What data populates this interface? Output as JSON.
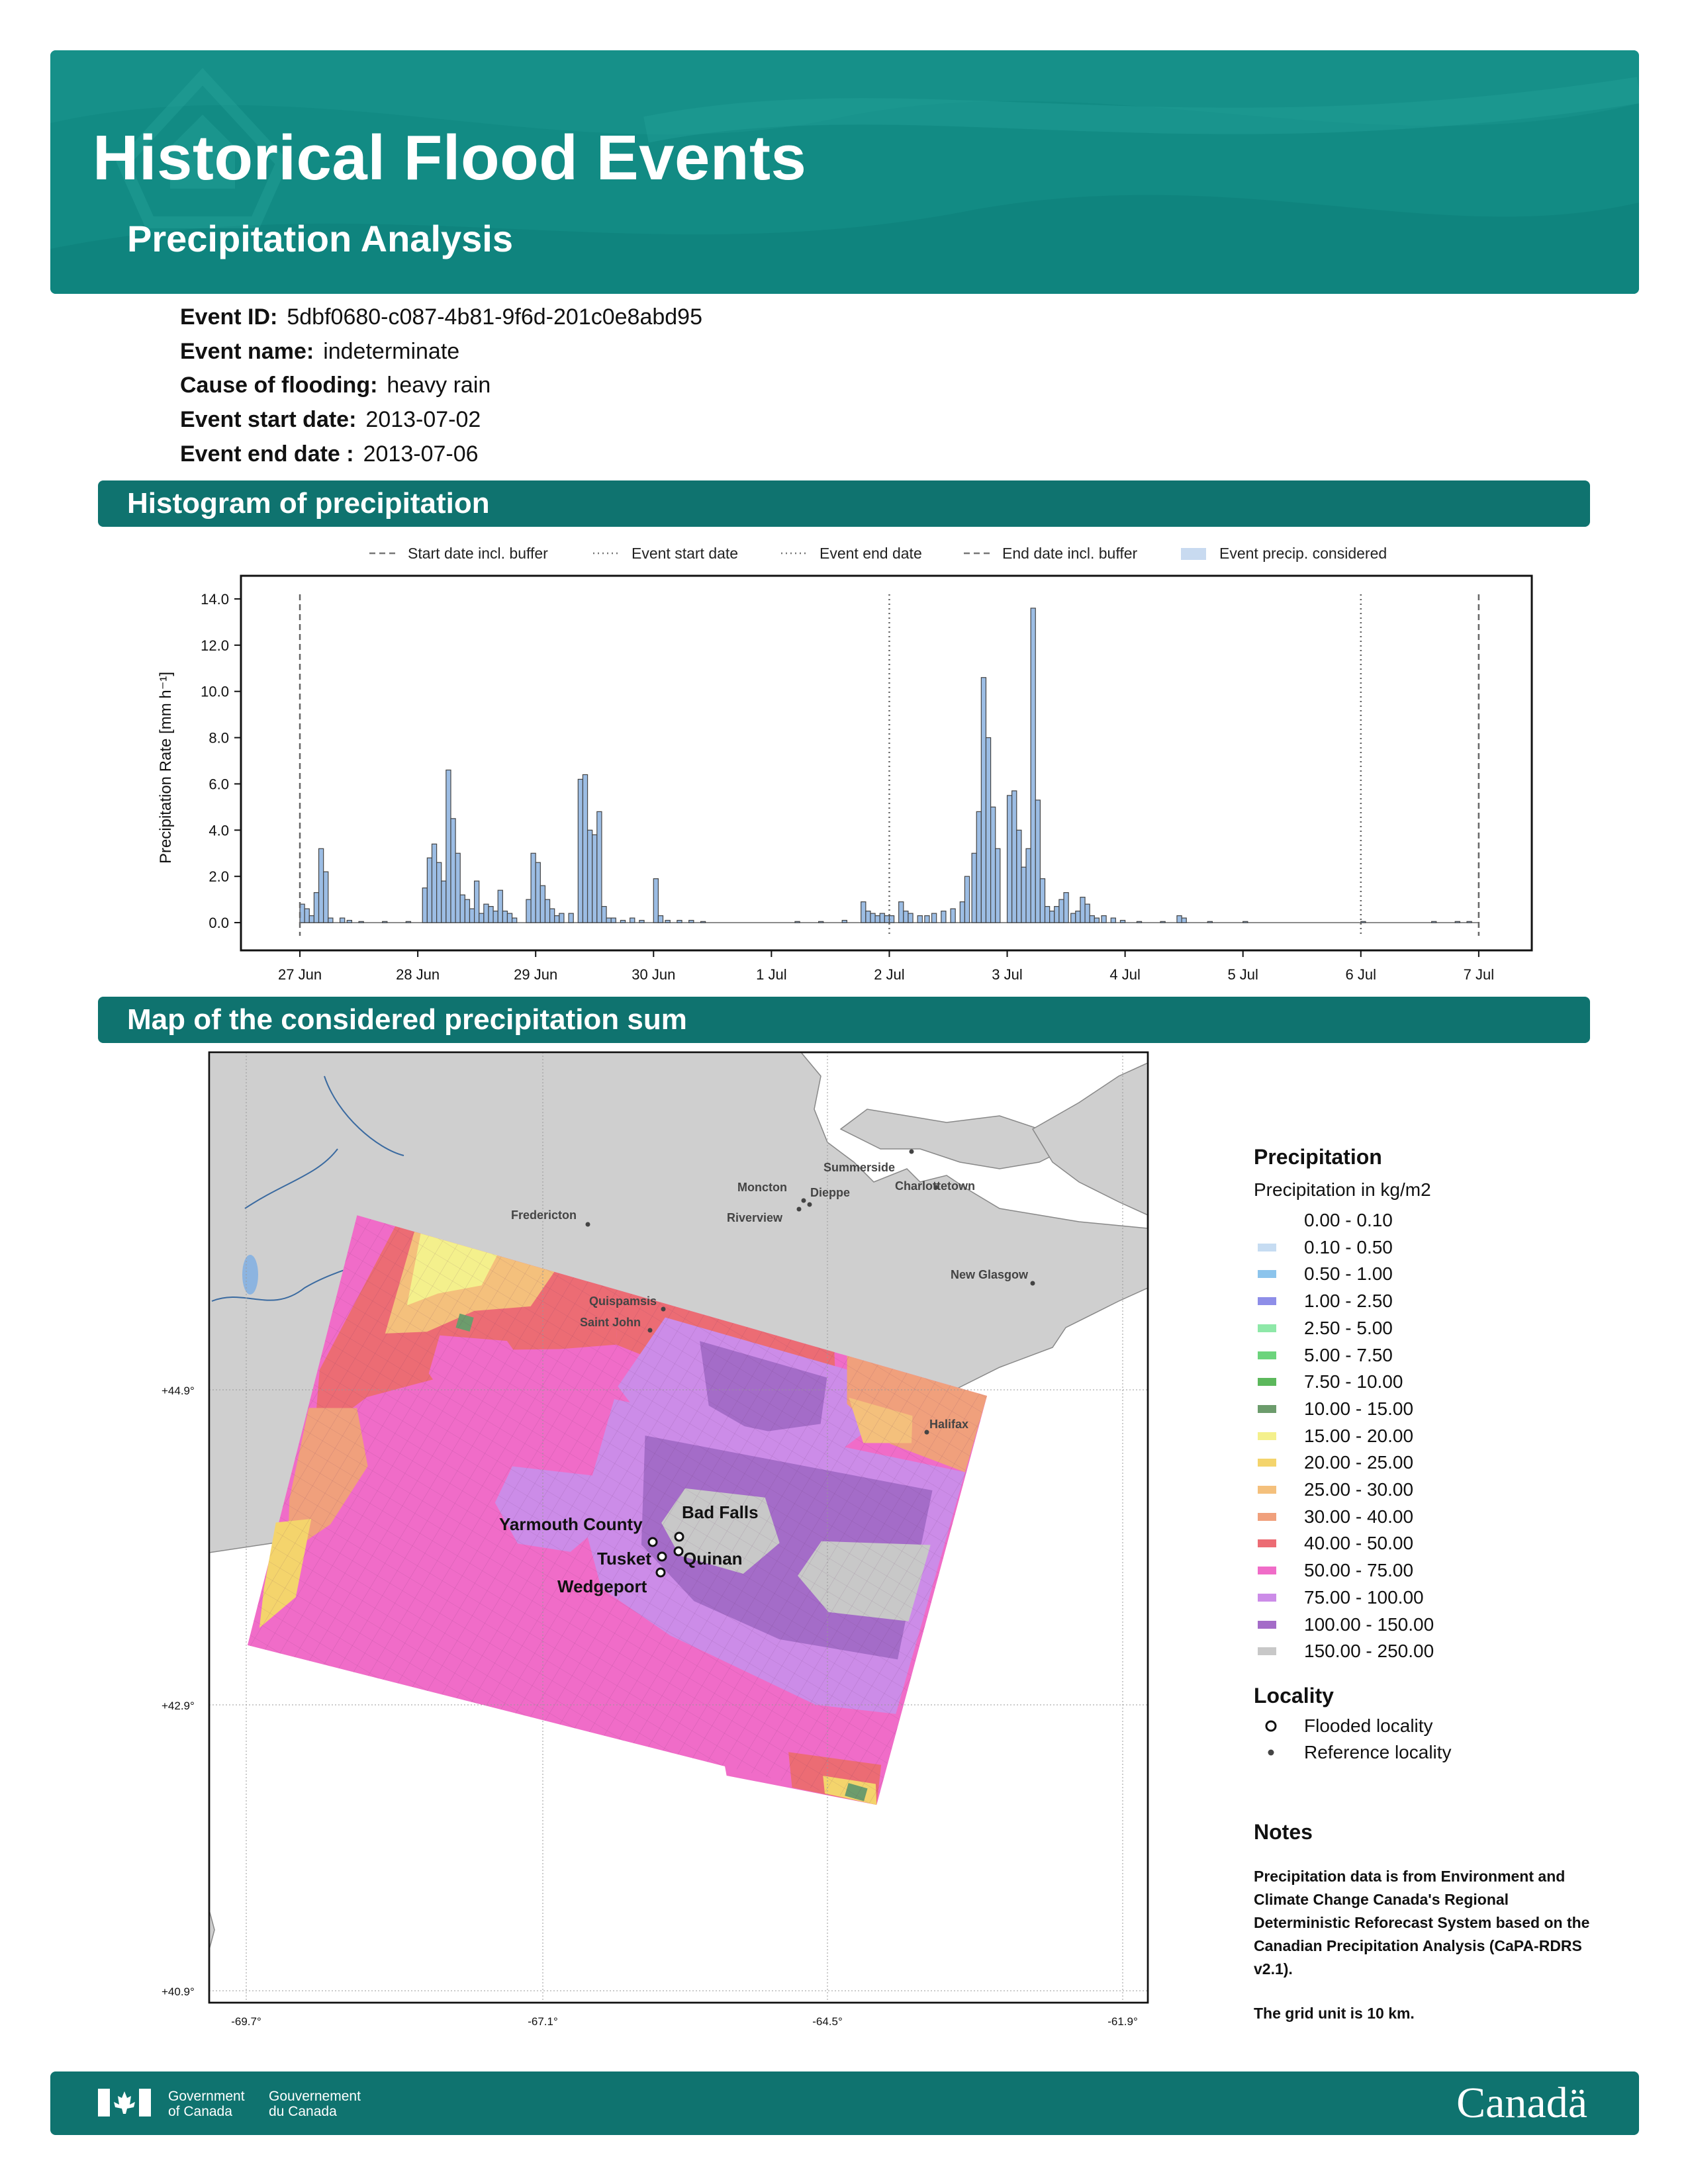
{
  "header": {
    "title": "Historical Flood Events",
    "subtitle": "Precipitation Analysis"
  },
  "event": {
    "id_label": "Event ID:",
    "id": "5dbf0680-c087-4b81-9f6d-201c0e8abd95",
    "name_label": "Event name:",
    "name": "indeterminate",
    "cause_label": "Cause of flooding:",
    "cause": "heavy rain",
    "start_label": "Event start date:",
    "start": "2013-07-02",
    "end_label": "Event end date :",
    "end": "2013-07-06"
  },
  "sections": {
    "histogram": "Histogram of precipitation",
    "map": "Map of the considered precipitation sum"
  },
  "chart_data": {
    "type": "bar",
    "ylabel": "Precipitation Rate [mm h⁻¹]",
    "ylim": [
      -1.2,
      15.0
    ],
    "yticks": [
      "0.0",
      "2.0",
      "4.0",
      "6.0",
      "8.0",
      "10.0",
      "12.0",
      "14.0"
    ],
    "xticks": [
      "27 Jun",
      "28 Jun",
      "29 Jun",
      "30 Jun",
      "1 Jul",
      "2 Jul",
      "3 Jul",
      "4 Jul",
      "5 Jul",
      "6 Jul",
      "7 Jul"
    ],
    "xlim_days": [
      -0.5,
      10.45
    ],
    "legend": {
      "position": "top",
      "items": [
        "Start date incl. buffer",
        "Event start date",
        "Event end date",
        "End date incl. buffer",
        "Event precip. considered"
      ]
    },
    "vlines": [
      {
        "name": "Start date incl. buffer",
        "day": 0.0,
        "style": "dashed"
      },
      {
        "name": "Event start date",
        "day": 5.0,
        "style": "dotted"
      },
      {
        "name": "Event end date",
        "day": 9.0,
        "style": "dotted"
      },
      {
        "name": "End date incl. buffer",
        "day": 10.0,
        "style": "dashed"
      }
    ],
    "bin_width_days": 0.04,
    "points": [
      [
        0.0,
        0.8
      ],
      [
        0.04,
        0.6
      ],
      [
        0.08,
        0.3
      ],
      [
        0.12,
        1.3
      ],
      [
        0.16,
        3.2
      ],
      [
        0.2,
        2.2
      ],
      [
        0.24,
        0.2
      ],
      [
        0.34,
        0.2
      ],
      [
        0.4,
        0.1
      ],
      [
        0.5,
        0.05
      ],
      [
        0.7,
        0.05
      ],
      [
        0.9,
        0.05
      ],
      [
        1.04,
        1.5
      ],
      [
        1.08,
        2.8
      ],
      [
        1.12,
        3.4
      ],
      [
        1.16,
        2.6
      ],
      [
        1.2,
        1.8
      ],
      [
        1.24,
        6.6
      ],
      [
        1.28,
        4.5
      ],
      [
        1.32,
        3.0
      ],
      [
        1.36,
        1.2
      ],
      [
        1.4,
        1.0
      ],
      [
        1.44,
        0.6
      ],
      [
        1.48,
        1.8
      ],
      [
        1.52,
        0.4
      ],
      [
        1.56,
        0.8
      ],
      [
        1.6,
        0.7
      ],
      [
        1.64,
        0.5
      ],
      [
        1.68,
        1.4
      ],
      [
        1.72,
        0.5
      ],
      [
        1.76,
        0.4
      ],
      [
        1.8,
        0.2
      ],
      [
        1.92,
        1.0
      ],
      [
        1.96,
        3.0
      ],
      [
        2.0,
        2.6
      ],
      [
        2.04,
        1.6
      ],
      [
        2.08,
        1.0
      ],
      [
        2.12,
        0.6
      ],
      [
        2.16,
        0.3
      ],
      [
        2.2,
        0.4
      ],
      [
        2.28,
        0.4
      ],
      [
        2.36,
        6.2
      ],
      [
        2.4,
        6.4
      ],
      [
        2.44,
        4.0
      ],
      [
        2.48,
        3.8
      ],
      [
        2.52,
        4.8
      ],
      [
        2.56,
        0.7
      ],
      [
        2.6,
        0.2
      ],
      [
        2.64,
        0.2
      ],
      [
        2.72,
        0.1
      ],
      [
        2.8,
        0.2
      ],
      [
        2.88,
        0.1
      ],
      [
        3.0,
        1.9
      ],
      [
        3.04,
        0.3
      ],
      [
        3.1,
        0.1
      ],
      [
        3.2,
        0.1
      ],
      [
        3.3,
        0.1
      ],
      [
        3.4,
        0.05
      ],
      [
        4.2,
        0.05
      ],
      [
        4.4,
        0.05
      ],
      [
        4.6,
        0.1
      ],
      [
        4.76,
        0.9
      ],
      [
        4.8,
        0.5
      ],
      [
        4.84,
        0.4
      ],
      [
        4.88,
        0.3
      ],
      [
        4.92,
        0.4
      ],
      [
        4.96,
        0.3
      ],
      [
        5.0,
        0.3
      ],
      [
        5.08,
        0.9
      ],
      [
        5.12,
        0.5
      ],
      [
        5.16,
        0.4
      ],
      [
        5.24,
        0.3
      ],
      [
        5.3,
        0.3
      ],
      [
        5.36,
        0.4
      ],
      [
        5.44,
        0.5
      ],
      [
        5.52,
        0.6
      ],
      [
        5.6,
        0.9
      ],
      [
        5.64,
        2.0
      ],
      [
        5.7,
        3.0
      ],
      [
        5.74,
        4.8
      ],
      [
        5.78,
        10.6
      ],
      [
        5.82,
        8.0
      ],
      [
        5.86,
        5.0
      ],
      [
        5.9,
        3.2
      ],
      [
        6.0,
        5.5
      ],
      [
        6.04,
        5.7
      ],
      [
        6.08,
        4.0
      ],
      [
        6.12,
        2.4
      ],
      [
        6.16,
        3.2
      ],
      [
        6.2,
        13.6
      ],
      [
        6.24,
        5.3
      ],
      [
        6.28,
        1.9
      ],
      [
        6.32,
        0.7
      ],
      [
        6.36,
        0.5
      ],
      [
        6.4,
        0.7
      ],
      [
        6.44,
        1.0
      ],
      [
        6.48,
        1.3
      ],
      [
        6.54,
        0.4
      ],
      [
        6.58,
        0.5
      ],
      [
        6.62,
        1.1
      ],
      [
        6.66,
        0.8
      ],
      [
        6.7,
        0.3
      ],
      [
        6.74,
        0.2
      ],
      [
        6.8,
        0.3
      ],
      [
        6.88,
        0.2
      ],
      [
        6.96,
        0.1
      ],
      [
        7.1,
        0.05
      ],
      [
        7.3,
        0.05
      ],
      [
        7.44,
        0.3
      ],
      [
        7.48,
        0.2
      ],
      [
        7.7,
        0.05
      ],
      [
        8.0,
        0.05
      ],
      [
        9.0,
        0.05
      ],
      [
        9.6,
        0.05
      ],
      [
        9.8,
        0.05
      ],
      [
        9.9,
        0.05
      ]
    ]
  },
  "map": {
    "lat_labels": [
      "+44.9°",
      "+42.9°",
      "+40.9°"
    ],
    "lon_labels": [
      "-69.7°",
      "-67.1°",
      "-64.5°",
      "-61.9°"
    ],
    "reference_localities": [
      "Summerside",
      "Charlottetown",
      "Moncton",
      "Dieppe",
      "Riverview",
      "Fredericton",
      "New Glasgow",
      "Quispamsis",
      "Saint John",
      "Halifax"
    ],
    "flooded_localities": [
      "Yarmouth County",
      "Bad Falls",
      "Tusket",
      "Quinan",
      "Wedgeport"
    ]
  },
  "legend": {
    "title": "Precipitation",
    "subtitle": "Precipitation in kg/m2",
    "classes": [
      {
        "label": "0.00 - 0.10",
        "color": "#ffffff"
      },
      {
        "label": "0.10 - 0.50",
        "color": "#c6dcf2"
      },
      {
        "label": "0.50 - 1.00",
        "color": "#8cc4ec"
      },
      {
        "label": "1.00 - 2.50",
        "color": "#8e8ee8"
      },
      {
        "label": "2.50 - 5.00",
        "color": "#8ee8a8"
      },
      {
        "label": "5.00 - 7.50",
        "color": "#6cd47c"
      },
      {
        "label": "7.50 - 10.00",
        "color": "#5cb85c"
      },
      {
        "label": "10.00 - 15.00",
        "color": "#6c9c6c"
      },
      {
        "label": "15.00 - 20.00",
        "color": "#f4f08c"
      },
      {
        "label": "20.00 - 25.00",
        "color": "#f4d46c"
      },
      {
        "label": "25.00 - 30.00",
        "color": "#f4c07c"
      },
      {
        "label": "30.00 - 40.00",
        "color": "#f0a07c"
      },
      {
        "label": "40.00 - 50.00",
        "color": "#ec6c74"
      },
      {
        "label": "50.00 - 75.00",
        "color": "#f06cc8"
      },
      {
        "label": "75.00 - 100.00",
        "color": "#cc8ce8"
      },
      {
        "label": "100.00 - 150.00",
        "color": "#a46cc8"
      },
      {
        "label": "150.00 - 250.00",
        "color": "#c8c8c8"
      }
    ],
    "locality_title": "Locality",
    "flooded_label": "Flooded locality",
    "reference_label": "Reference locality"
  },
  "notes": {
    "title": "Notes",
    "text": "Precipitation data is from Environment and Climate Change Canada's Regional Deterministic Reforecast System based on the Canadian Precipitation Analysis (CaPA-RDRS v2.1).",
    "grid": "The grid unit is 10 km."
  },
  "footer": {
    "gov_en_1": "Government",
    "gov_en_2": "of Canada",
    "gov_fr_1": "Gouvernement",
    "gov_fr_2": "du Canada",
    "wordmark": "Canadä"
  }
}
